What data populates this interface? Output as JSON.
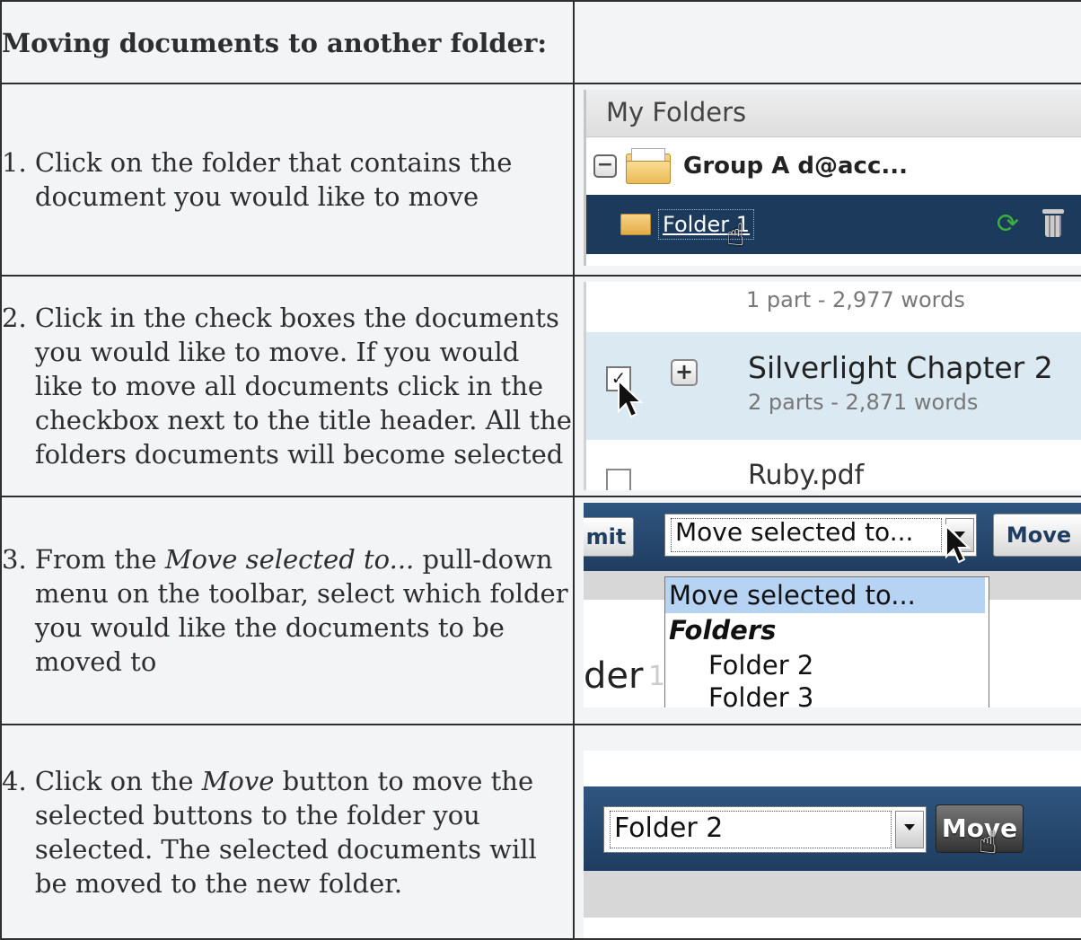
{
  "header": {
    "title": "Moving documents to another folder:"
  },
  "steps": [
    {
      "num": "1.",
      "text": "Click on the folder that contains the document you would like to move"
    },
    {
      "num": "2.",
      "text": "Click in the check boxes the documents you would like to move. If you would like to move all documents click in the checkbox next to the title header. All the folders documents will become selected"
    },
    {
      "num": "3.",
      "text_before": "From the ",
      "text_em": "Move selected to...",
      "text_after": " pull-down menu on the toolbar, select which folder you would like the documents to be moved to"
    },
    {
      "num": "4.",
      "text_before": "Click on the ",
      "text_em": "Move",
      "text_after": " button to move the selected buttons to the folder you selected. The selected documents will be moved to the new folder."
    }
  ],
  "shot1": {
    "panel_title": "My Folders",
    "group_label": "Group A d@acc...",
    "selected_folder": "Folder 1",
    "expander": "−"
  },
  "shot2": {
    "meta_top": "1 part - 2,977 words",
    "doc_title": "Silverlight Chapter 2",
    "doc_meta": "2 parts - 2,871 words",
    "next_doc": "Ruby.pdf",
    "check_mark": "✓",
    "expander": "+"
  },
  "shot3": {
    "left_button": "mit",
    "select_value": "Move selected to...",
    "right_button": "Move",
    "options": [
      "Move selected to...",
      "Folders",
      "Folder 2",
      "Folder 3"
    ],
    "partial_text": "der",
    "partial_num": "1"
  },
  "shot4": {
    "select_value": "Folder 2",
    "move_button": "Move"
  }
}
